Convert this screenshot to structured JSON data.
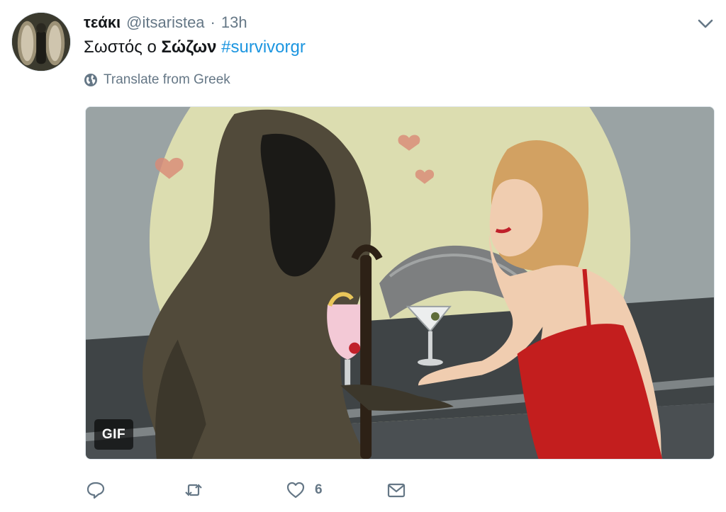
{
  "tweet": {
    "author": {
      "display_name": "τεάκι",
      "handle": "@itsaristea",
      "separator": "·",
      "time": "13h"
    },
    "text": {
      "part1": "Σωστός ο ",
      "bold": "Σώζων",
      "space": " ",
      "hashtag": "#survivorgr"
    },
    "translate_label": "Translate from Greek",
    "media": {
      "gif_badge": "GIF"
    },
    "actions": {
      "reply": {
        "icon": "reply-icon",
        "count": ""
      },
      "retweet": {
        "icon": "retweet-icon",
        "count": ""
      },
      "like": {
        "icon": "like-icon",
        "count": "6"
      },
      "dm": {
        "icon": "direct-message-icon",
        "count": ""
      }
    },
    "menu_icon": "chevron-down-icon"
  },
  "colors": {
    "text": "#14171a",
    "muted": "#657786",
    "link": "#1b95e0"
  }
}
